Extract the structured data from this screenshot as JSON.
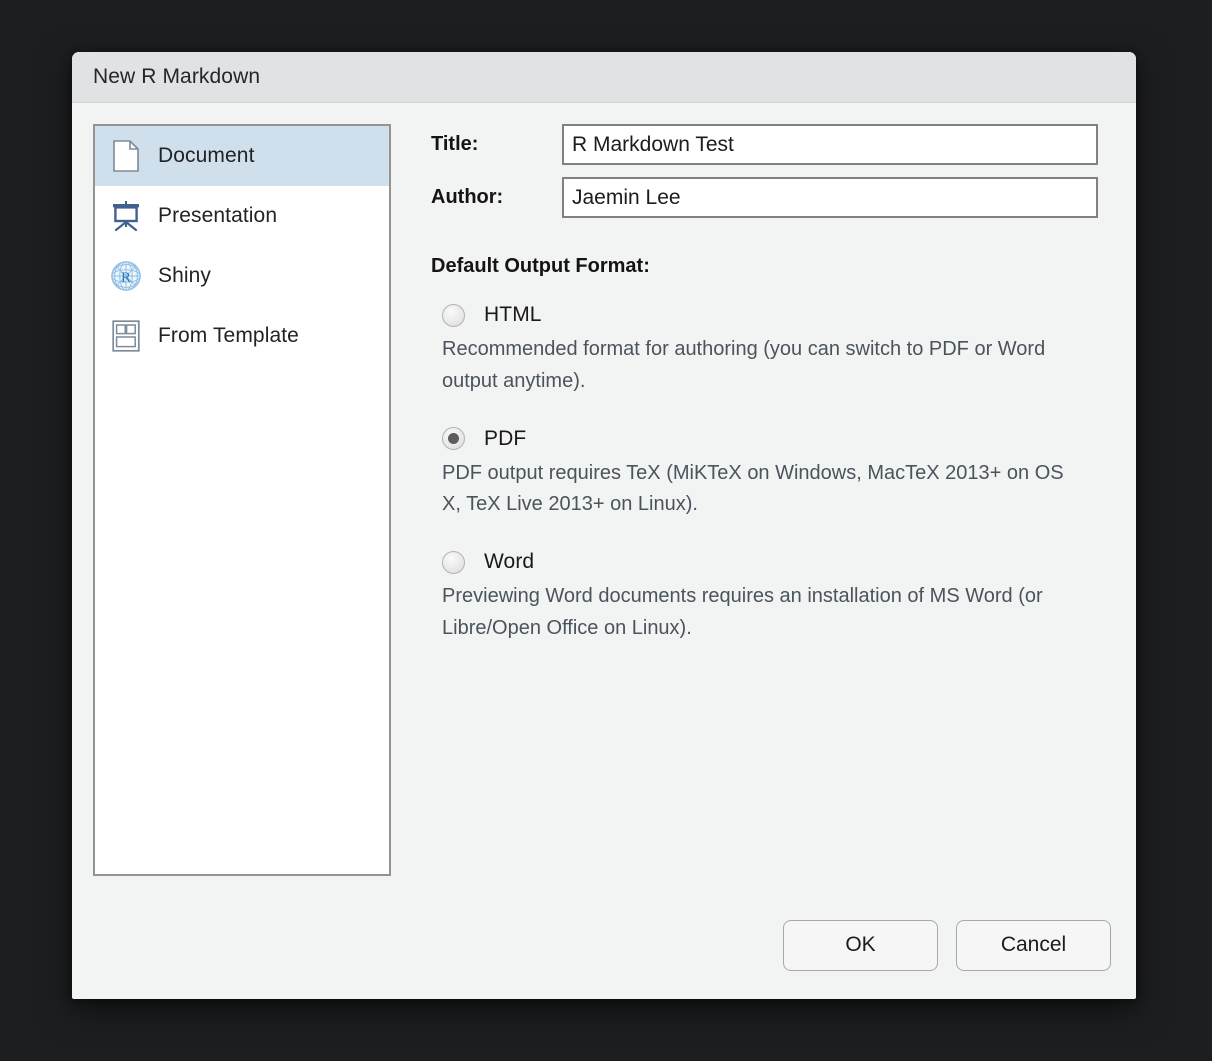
{
  "window": {
    "title": "New R Markdown"
  },
  "sidebar": {
    "items": [
      {
        "label": "Document",
        "icon": "document-page-icon",
        "selected": true
      },
      {
        "label": "Presentation",
        "icon": "presentation-icon",
        "selected": false
      },
      {
        "label": "Shiny",
        "icon": "shiny-globe-r-icon",
        "selected": false
      },
      {
        "label": "From Template",
        "icon": "template-grid-icon",
        "selected": false
      }
    ]
  },
  "form": {
    "title_label": "Title:",
    "title_value": "R Markdown Test",
    "title_placeholder": "",
    "author_label": "Author:",
    "author_value": "Jaemin Lee",
    "author_placeholder": ""
  },
  "output_format": {
    "heading": "Default Output Format:",
    "options": [
      {
        "label": "HTML",
        "selected": false,
        "description": "Recommended format for authoring (you can switch to PDF or Word output anytime)."
      },
      {
        "label": "PDF",
        "selected": true,
        "description": "PDF output requires TeX (MiKTeX on Windows, MacTeX 2013+ on OS X, TeX Live 2013+ on Linux)."
      },
      {
        "label": "Word",
        "selected": false,
        "description": "Previewing Word documents requires an installation of MS Word (or Libre/Open Office on Linux)."
      }
    ]
  },
  "footer": {
    "ok_label": "OK",
    "cancel_label": "Cancel"
  },
  "colors": {
    "desktop_background": "#1d1e21",
    "titlebar": "#e1e2e4",
    "dialog_background": "#f2f3f3",
    "selection_highlight": "#cfdfec",
    "icon_blue": "#41618f",
    "shiny_blue": "#4a8fd0",
    "description_text": "#4a545c",
    "input_border": "#818181"
  }
}
